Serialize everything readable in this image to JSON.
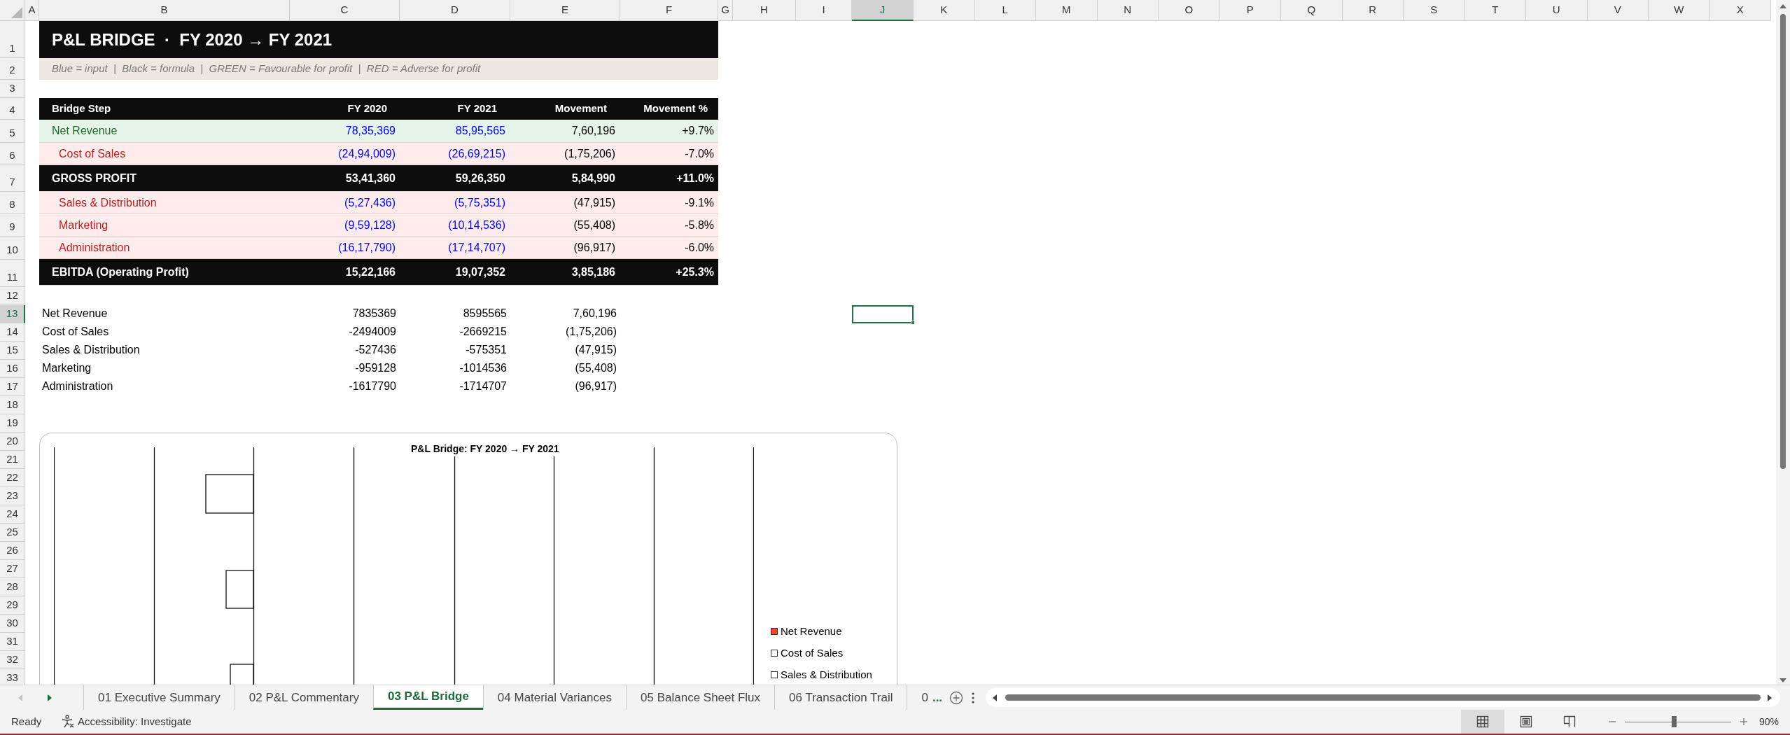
{
  "column_headers": [
    {
      "label": "A",
      "selected": false
    },
    {
      "label": "B",
      "selected": false
    },
    {
      "label": "C",
      "selected": false
    },
    {
      "label": "D",
      "selected": false
    },
    {
      "label": "E",
      "selected": false
    },
    {
      "label": "F",
      "selected": false
    },
    {
      "label": "G",
      "selected": false
    },
    {
      "label": "H",
      "selected": false
    },
    {
      "label": "I",
      "selected": false
    },
    {
      "label": "J",
      "selected": true
    },
    {
      "label": "K",
      "selected": false
    },
    {
      "label": "L",
      "selected": false
    },
    {
      "label": "M",
      "selected": false
    },
    {
      "label": "N",
      "selected": false
    },
    {
      "label": "O",
      "selected": false
    },
    {
      "label": "P",
      "selected": false
    },
    {
      "label": "Q",
      "selected": false
    },
    {
      "label": "R",
      "selected": false
    },
    {
      "label": "S",
      "selected": false
    },
    {
      "label": "T",
      "selected": false
    },
    {
      "label": "U",
      "selected": false
    },
    {
      "label": "V",
      "selected": false
    },
    {
      "label": "W",
      "selected": false
    },
    {
      "label": "X",
      "selected": false
    }
  ],
  "row_headers": [
    {
      "label": "1",
      "selected": false
    },
    {
      "label": "2",
      "selected": false
    },
    {
      "label": "3",
      "selected": false
    },
    {
      "label": "4",
      "selected": false
    },
    {
      "label": "5",
      "selected": false
    },
    {
      "label": "6",
      "selected": false
    },
    {
      "label": "7",
      "selected": false
    },
    {
      "label": "8",
      "selected": false
    },
    {
      "label": "9",
      "selected": false
    },
    {
      "label": "10",
      "selected": false
    },
    {
      "label": "11",
      "selected": false
    },
    {
      "label": "12",
      "selected": false
    },
    {
      "label": "13",
      "selected": true
    },
    {
      "label": "14",
      "selected": false
    },
    {
      "label": "15",
      "selected": false
    },
    {
      "label": "16",
      "selected": false
    },
    {
      "label": "17",
      "selected": false
    },
    {
      "label": "18",
      "selected": false
    },
    {
      "label": "19",
      "selected": false
    },
    {
      "label": "20",
      "selected": false
    },
    {
      "label": "21",
      "selected": false
    },
    {
      "label": "22",
      "selected": false
    },
    {
      "label": "23",
      "selected": false
    },
    {
      "label": "24",
      "selected": false
    },
    {
      "label": "25",
      "selected": false
    },
    {
      "label": "26",
      "selected": false
    },
    {
      "label": "27",
      "selected": false
    },
    {
      "label": "28",
      "selected": false
    },
    {
      "label": "29",
      "selected": false
    },
    {
      "label": "30",
      "selected": false
    },
    {
      "label": "31",
      "selected": false
    },
    {
      "label": "32",
      "selected": false
    },
    {
      "label": "33",
      "selected": false
    }
  ],
  "title": "P&L BRIDGE  ·  FY 2020 → FY 2021",
  "note": "Blue = input  |  Black = formula  |  GREEN = Favourable for profit  |  RED = Adverse for profit",
  "bridge_table": {
    "columns": [
      "Bridge Step",
      "FY 2020",
      "FY 2021",
      "Movement",
      "Movement %"
    ],
    "rows": [
      {
        "kind": "revenue",
        "step": "Net Revenue",
        "fy2020": "78,35,369",
        "fy2021": "85,95,565",
        "movement": "7,60,196",
        "movement_pct": "+9.7%"
      },
      {
        "kind": "cost",
        "step": "Cost of Sales",
        "fy2020": "(24,94,009)",
        "fy2021": "(26,69,215)",
        "movement": "(1,75,206)",
        "movement_pct": "-7.0%"
      },
      {
        "kind": "total",
        "step": "GROSS PROFIT",
        "fy2020": "53,41,360",
        "fy2021": "59,26,350",
        "movement": "5,84,990",
        "movement_pct": "+11.0%"
      },
      {
        "kind": "cost",
        "step": "Sales & Distribution",
        "fy2020": "(5,27,436)",
        "fy2021": "(5,75,351)",
        "movement": "(47,915)",
        "movement_pct": "-9.1%"
      },
      {
        "kind": "cost",
        "step": "Marketing",
        "fy2020": "(9,59,128)",
        "fy2021": "(10,14,536)",
        "movement": "(55,408)",
        "movement_pct": "-5.8%"
      },
      {
        "kind": "cost",
        "step": "Administration",
        "fy2020": "(16,17,790)",
        "fy2021": "(17,14,707)",
        "movement": "(96,917)",
        "movement_pct": "-6.0%"
      },
      {
        "kind": "total",
        "step": "EBITDA (Operating Profit)",
        "fy2020": "15,22,166",
        "fy2021": "19,07,352",
        "movement": "3,85,186",
        "movement_pct": "+25.3%"
      }
    ]
  },
  "helper_rows": [
    {
      "label": "Net Revenue",
      "c": "7835369",
      "d": "8595565",
      "e": "7,60,196"
    },
    {
      "label": "Cost of Sales",
      "c": "-2494009",
      "d": "-2669215",
      "e": "(1,75,206)"
    },
    {
      "label": "Sales & Distribution",
      "c": "-527436",
      "d": "-575351",
      "e": "(47,915)"
    },
    {
      "label": "Marketing",
      "c": "-959128",
      "d": "-1014536",
      "e": "(55,408)"
    },
    {
      "label": "Administration",
      "c": "-1617790",
      "d": "-1714707",
      "e": "(96,917)"
    }
  ],
  "chart": {
    "title": "P&L Bridge: FY 2020 → FY 2021",
    "legend": [
      {
        "label": "Net Revenue",
        "color": "#f0462a"
      },
      {
        "label": "Cost of Sales",
        "color": "#ffffff"
      },
      {
        "label": "Sales & Distribution",
        "color": "#ffffff"
      }
    ]
  },
  "sheet_tabs": [
    {
      "label": "01 Executive Summary",
      "selected": false
    },
    {
      "label": "02 P&L Commentary",
      "selected": false
    },
    {
      "label": "03 P&L Bridge",
      "selected": true
    },
    {
      "label": "04 Material Variances",
      "selected": false
    },
    {
      "label": "05 Balance Sheet Flux",
      "selected": false
    },
    {
      "label": "06 Transaction Trail",
      "selected": false
    },
    {
      "label": "0",
      "selected": false
    }
  ],
  "more_tabs": "...",
  "status_bar": {
    "mode": "Ready",
    "accessibility": "Accessibility: Investigate",
    "views": [
      {
        "kind": "normal",
        "selected": true
      },
      {
        "kind": "page_layout",
        "selected": false
      },
      {
        "kind": "page_break",
        "selected": false
      }
    ],
    "zoom_slider": {
      "level": 0.46
    },
    "zoom": "90%"
  }
}
